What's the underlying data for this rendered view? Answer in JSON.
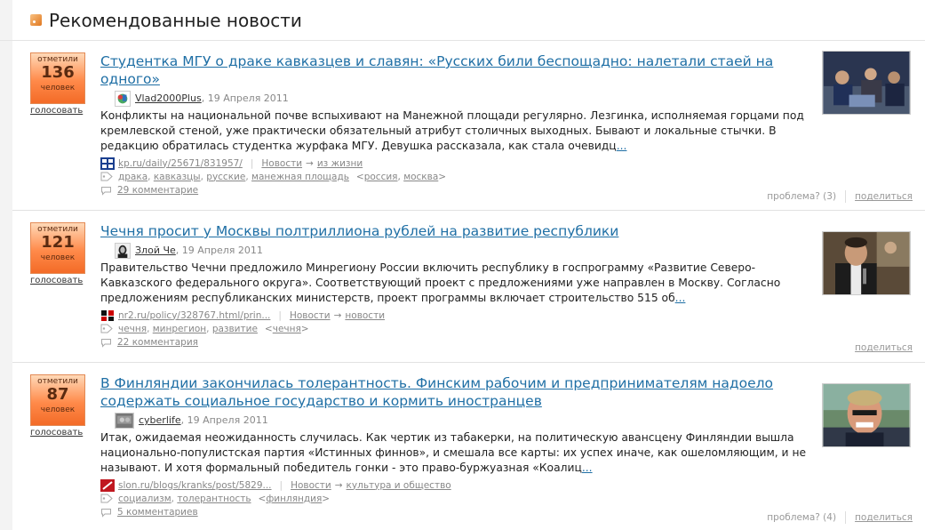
{
  "header": {
    "title": "Рекомендованные новости"
  },
  "items": [
    {
      "vote": {
        "top": "отметили",
        "count": "136",
        "bottom": "человек",
        "link": "голосовать"
      },
      "title": "Студентка МГУ о драке кавказцев и славян: «Русских били беспощадно: налетали стаей на одного»",
      "author": "Vlad2000Plus",
      "date": ", 19 Апреля 2011",
      "desc": "Конфликты на национальной почве вспыхивают на Манежной площади регулярно. Лезгинка, исполняемая горцами под кремлевской стеной, уже практически обязательный атрибут столичных выходных. Бывают и локальные стычки. В редакцию обратилась студентка журфака МГУ. Девушка рассказала, как стала очевидц",
      "more": "...",
      "source": "kp.ru/daily/25671/831957/",
      "cat1": "Новости",
      "arrow": "→",
      "cat2": "из жизни",
      "tags": [
        "драка",
        "кавказцы",
        "русские",
        "манежная площадь"
      ],
      "geo": [
        "россия",
        "москва"
      ],
      "comments": "29 комментарие",
      "problem": "проблема? (3)",
      "share": "поделиться"
    },
    {
      "vote": {
        "top": "отметили",
        "count": "121",
        "bottom": "человек",
        "link": "голосовать"
      },
      "title": "Чечня просит у Москвы полтриллиона рублей на развитие республики",
      "author": "Злой Че",
      "date": ", 19 Апреля 2011",
      "desc": "Правительство Чечни предложило Минрегиону России включить республику в госпрограмму «Развитие Северо-Кавказского федерального округа». Соответствующий проект с предложениями уже направлен в Москву. Согласно предложениям республиканских министерств, проект программы включает строительство 515 об",
      "more": "...",
      "source": "nr2.ru/policy/328767.html/prin...",
      "cat1": "Новости",
      "arrow": "→",
      "cat2": "новости",
      "tags": [
        "чечня",
        "минрегион",
        "развитие"
      ],
      "geo": [
        "чечня"
      ],
      "comments": "22 комментария",
      "problem": "",
      "share": "поделиться"
    },
    {
      "vote": {
        "top": "отметили",
        "count": "87",
        "bottom": "человек",
        "link": "голосовать"
      },
      "title": "В Финляндии закончилась толерантность. Финским рабочим и предпринимателям надоело содержать социальное государство и кормить иностранцев",
      "author": "cyberlife",
      "date": ", 19 Апреля 2011",
      "desc": "Итак, ожидаемая неожиданность случилась. Как чертик из табакерки, на политическую авансцену Финляндии вышла национально-популистская партия «Истинных финнов», и смешала все карты: их успех иначе, как ошеломляющим, и не называют. И хотя формальный победитель гонки - это право-буржуазная «Коалиц",
      "more": "...",
      "source": "slon.ru/blogs/kranks/post/5829...",
      "cat1": "Новости",
      "arrow": "→",
      "cat2": "культура и общество",
      "tags": [
        "социализм",
        "толерантность"
      ],
      "geo": [
        "финляндия"
      ],
      "comments": "5 комментариев",
      "problem": "проблема? (4)",
      "share": "поделиться"
    }
  ]
}
